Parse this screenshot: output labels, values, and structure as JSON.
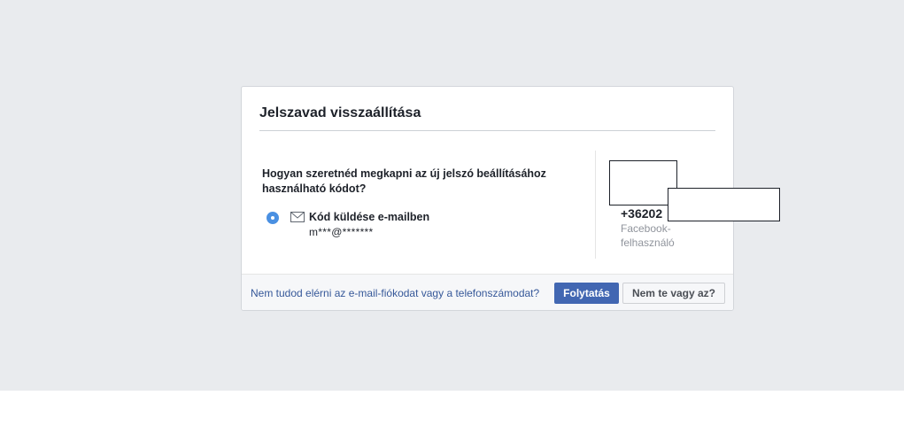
{
  "dialog": {
    "title": "Jelszavad visszaállítása",
    "question": "Hogyan szeretnéd megkapni az új jelszó beállításához használható kódot?",
    "option": {
      "label": "Kód küldése e-mailben",
      "email": "m***@*******",
      "icon": "envelope-icon",
      "selected": true
    },
    "account": {
      "phone": "+36202",
      "user_type": "Facebook-felhasználó"
    },
    "footer": {
      "no_access_link": "Nem tudod elérni az e-mail-fiókodat vagy a telefonszámodat?",
      "continue_button": "Folytatás",
      "not_you_button": "Nem te vagy az?"
    }
  },
  "colors": {
    "page_background": "#e9ebee",
    "primary_button": "#4267b2",
    "link": "#365899",
    "radio_selected": "#4a90e2"
  }
}
